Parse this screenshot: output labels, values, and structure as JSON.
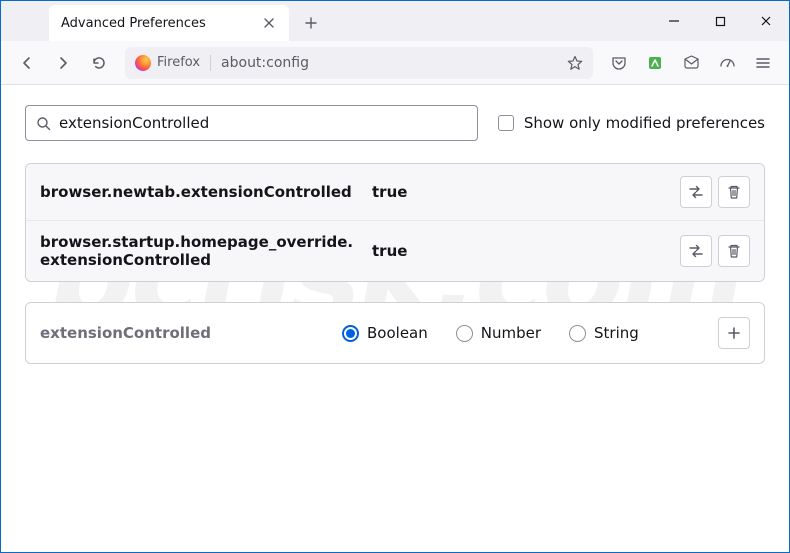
{
  "window": {
    "tab_title": "Advanced Preferences",
    "identity_label": "Firefox",
    "url": "about:config"
  },
  "config": {
    "search_value": "extensionControlled",
    "show_modified_label": "Show only modified preferences",
    "prefs": [
      {
        "name": "browser.newtab.extensionControlled",
        "value": "true"
      },
      {
        "name": "browser.startup.homepage_override.extensionControlled",
        "value": "true"
      }
    ],
    "new_pref": {
      "name": "extensionControlled",
      "types": [
        "Boolean",
        "Number",
        "String"
      ],
      "selected": "Boolean"
    }
  }
}
